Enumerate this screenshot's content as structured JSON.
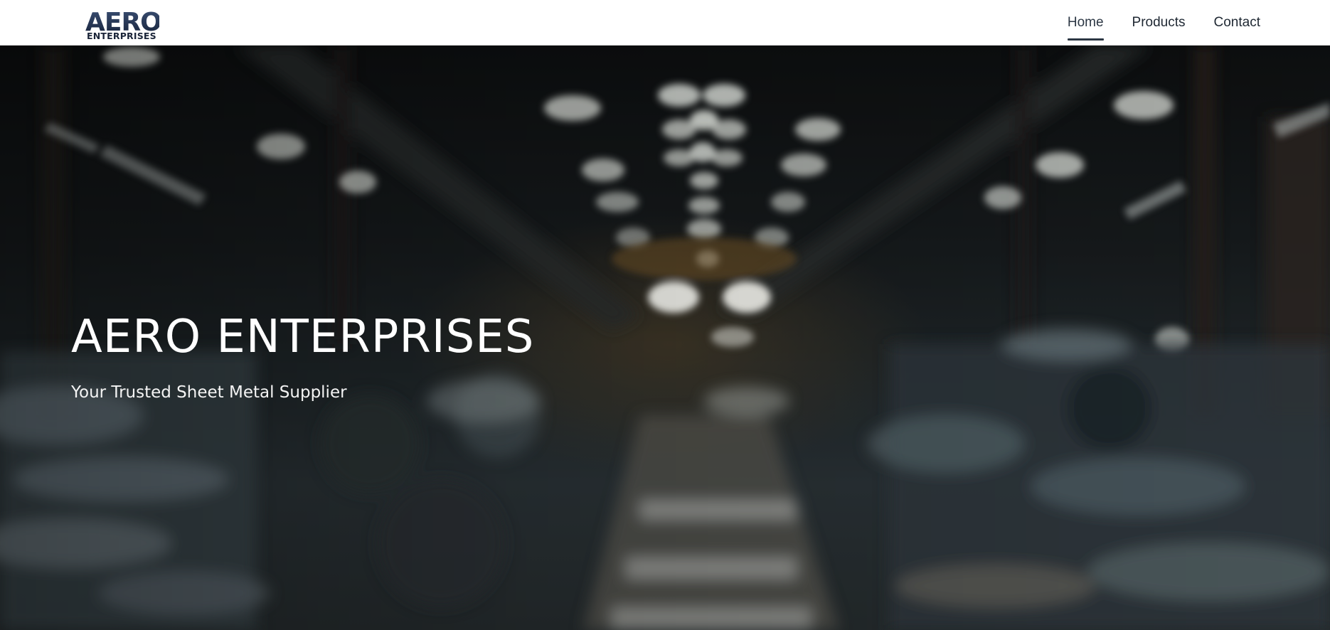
{
  "header": {
    "logo": {
      "word": "AERO",
      "subword": "ENTERPRISES"
    },
    "nav": [
      {
        "label": "Home",
        "active": true
      },
      {
        "label": "Products",
        "active": false
      },
      {
        "label": "Contact",
        "active": false
      }
    ]
  },
  "hero": {
    "title": "AERO ENTERPRISES",
    "subtitle": "Your Trusted Sheet Metal Supplier",
    "background_description": "blurred-industrial-warehouse-photo"
  },
  "colors": {
    "header_bg": "#ffffff",
    "nav_text": "#1e2732",
    "active_underline": "#2c3744",
    "hero_text": "#ffffff",
    "logo_dark": "#1f2e4a"
  }
}
